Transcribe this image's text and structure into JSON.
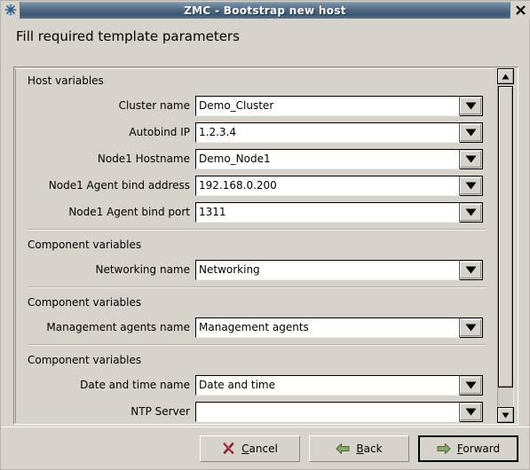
{
  "window": {
    "title": "ZMC - Bootstrap new host",
    "icon": "app-snowflake-icon",
    "close_label": "✕"
  },
  "heading": "Fill required template parameters",
  "sections": [
    {
      "title": "Host variables",
      "separator_above": false,
      "fields": [
        {
          "label": "Cluster name",
          "value": "Demo_Cluster",
          "placeholder": ""
        },
        {
          "label": "Autobind IP",
          "value": "1.2.3.4",
          "placeholder": ""
        },
        {
          "label": "Node1 Hostname",
          "value": "Demo_Node1",
          "placeholder": ""
        },
        {
          "label": "Node1 Agent bind address",
          "value": "192.168.0.200",
          "placeholder": ""
        },
        {
          "label": "Node1 Agent bind port",
          "value": "1311",
          "placeholder": ""
        }
      ]
    },
    {
      "title": "Component variables",
      "separator_above": true,
      "fields": [
        {
          "label": "Networking name",
          "value": "Networking",
          "placeholder": ""
        }
      ]
    },
    {
      "title": "Component variables",
      "separator_above": true,
      "fields": [
        {
          "label": "Management agents name",
          "value": "Management agents",
          "placeholder": ""
        }
      ]
    },
    {
      "title": "Component variables",
      "separator_above": true,
      "fields": [
        {
          "label": "Date and time name",
          "value": "Date and time",
          "placeholder": ""
        },
        {
          "label": "NTP Server",
          "value": "",
          "placeholder": ""
        }
      ]
    }
  ],
  "scrollbar": {
    "up_arrow": "scroll-up-icon",
    "down_arrow": "scroll-down-icon",
    "thumb_position_percent": 0
  },
  "buttons": [
    {
      "name": "cancel",
      "label_before": "",
      "mnemonic": "C",
      "label_after": "ancel",
      "icon": "cancel-x-icon",
      "focused": false
    },
    {
      "name": "back",
      "label_before": "",
      "mnemonic": "B",
      "label_after": "ack",
      "icon": "arrow-left-icon",
      "focused": false
    },
    {
      "name": "forward",
      "label_before": "",
      "mnemonic": "F",
      "label_after": "orward",
      "icon": "arrow-right-icon",
      "focused": true
    }
  ],
  "colors": {
    "window_bg": "#d6d3cc",
    "titlebar_accent": "#4e6880",
    "title_text": "#ffffff",
    "entry_bg": "#ffffff",
    "cancel_icon": "#8c1f2f",
    "nav_icon": "#6f8f54"
  }
}
